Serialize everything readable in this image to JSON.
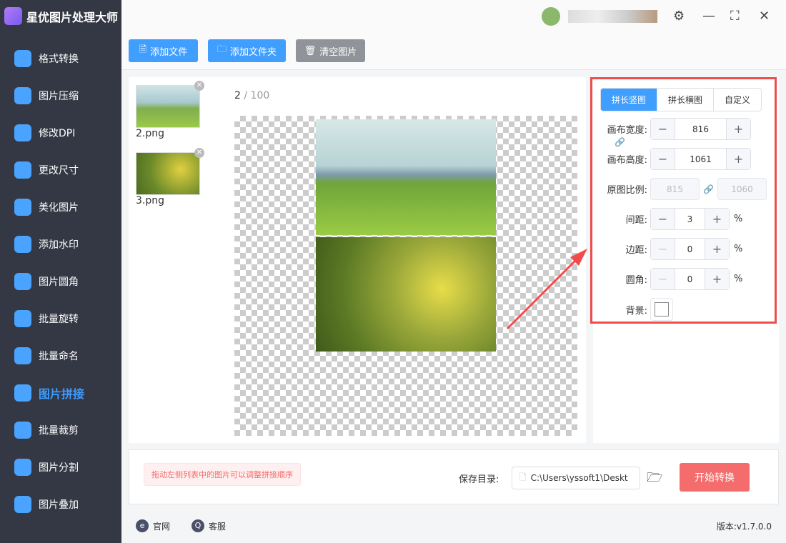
{
  "app": {
    "title": "星优图片处理大师"
  },
  "sidebar": {
    "items": [
      {
        "label": "格式转换",
        "icon": "format-convert-icon"
      },
      {
        "label": "图片压缩",
        "icon": "compress-icon"
      },
      {
        "label": "修改DPI",
        "icon": "dpi-icon"
      },
      {
        "label": "更改尺寸",
        "icon": "resize-icon"
      },
      {
        "label": "美化图片",
        "icon": "beautify-icon"
      },
      {
        "label": "添加水印",
        "icon": "watermark-icon"
      },
      {
        "label": "图片圆角",
        "icon": "round-corner-icon"
      },
      {
        "label": "批量旋转",
        "icon": "rotate-icon"
      },
      {
        "label": "批量命名",
        "icon": "rename-icon"
      },
      {
        "label": "图片拼接",
        "icon": "stitch-icon",
        "active": true
      },
      {
        "label": "批量裁剪",
        "icon": "crop-icon"
      },
      {
        "label": "图片分割",
        "icon": "split-icon"
      },
      {
        "label": "图片叠加",
        "icon": "overlay-icon"
      }
    ]
  },
  "toolbar": {
    "add_file": "添加文件",
    "add_folder": "添加文件夹",
    "clear": "清空图片"
  },
  "files": [
    {
      "name": "2.png"
    },
    {
      "name": "3.png"
    }
  ],
  "preview": {
    "current": "2",
    "total": "100",
    "sep": " / "
  },
  "settings": {
    "tabs": [
      "拼长竖图",
      "拼长横图",
      "自定义"
    ],
    "canvas_width": {
      "label": "画布宽度:",
      "value": "816"
    },
    "canvas_height": {
      "label": "画布高度:",
      "value": "1061"
    },
    "ratio": {
      "label": "原图比例:",
      "w": "815",
      "h": "1060"
    },
    "spacing": {
      "label": "间距:",
      "value": "3",
      "unit": "%"
    },
    "margin": {
      "label": "边距:",
      "value": "0",
      "unit": "%"
    },
    "radius": {
      "label": "圆角:",
      "value": "0",
      "unit": "%"
    },
    "background": {
      "label": "背景:",
      "color": "#ffffff"
    }
  },
  "bottom": {
    "hint": "拖动左侧列表中的图片可以调整拼接顺序",
    "save_label": "保存目录:",
    "save_path": "C:\\Users\\yssoft1\\Deskt",
    "start": "开始转换"
  },
  "footer": {
    "website": "官网",
    "support": "客服",
    "version": "版本:v1.7.0.0"
  },
  "colors": {
    "accent": "#409eff",
    "danger": "#f56c6c",
    "highlight": "#f04c4c",
    "sidebar": "#343844"
  }
}
